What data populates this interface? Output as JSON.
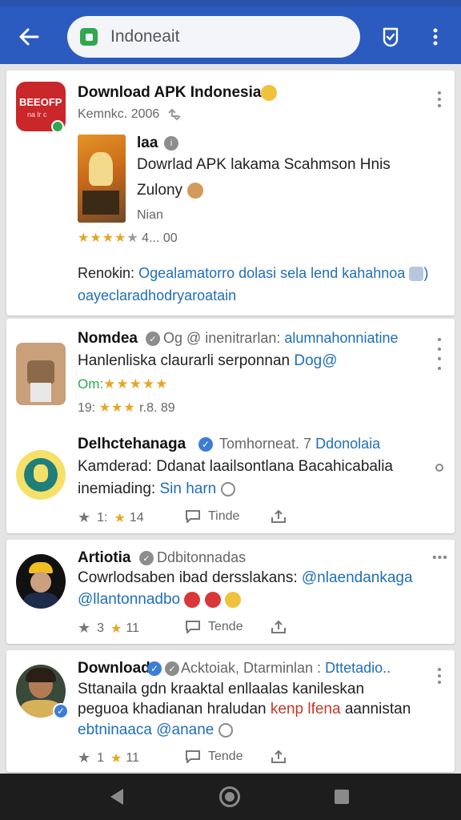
{
  "search": {
    "value": "Indoneait"
  },
  "posts": [
    {
      "title": "Download APK Indonesia",
      "meta": "Kemnkc. 2006",
      "avatar_text": "BEEOFP",
      "avatar_sub": "na lr c",
      "app": {
        "name": "laa",
        "desc_line1": "Dowrlad APK lakama Scahmson Hnis",
        "desc_line2": "Zulony",
        "sub": "Nian",
        "rating_text": "4... 00"
      },
      "footer_prefix": "Renokin:",
      "footer_link1": "Ogealamatorro dolasi sela lend kahahnoa",
      "footer_link2": "oayeclaradhodryaroatain"
    },
    {
      "title": "Nomdea",
      "meta_prefix": "Og @ inenitrarlan:",
      "meta_link": "alumnahonniatine",
      "body_text": "Hanlenliska claurarli serponnan",
      "body_link": "Dog@",
      "rating_prefix": "Om:",
      "rating_text": "19: ",
      "rating_suffix": "r.8. 89"
    },
    {
      "title": "Delhctehanaga",
      "meta_prefix": "Tomhorneat. 7",
      "meta_link": "Ddonolaia",
      "body_text": "Kamderad: Ddanat laailsontlana Bacahicabalia",
      "body2_text": "inemiading:",
      "body2_link": "Sin harn",
      "action_reposts": "1:",
      "action_likes": "14",
      "action_comments": "Tinde"
    },
    {
      "title": "Artiotia",
      "meta": "Ddbitonnadas",
      "body_text": "Cowrlodsaben ibad dersslakans:",
      "body_link": "@nlaendankaga",
      "body2_link": "@llantonnadbo",
      "action_reposts": "3",
      "action_likes": "11",
      "action_comments": "Tende"
    },
    {
      "title": "Download",
      "meta_prefix": "Acktoiak, Dtarminlan :",
      "meta_link": "Dttetadio..",
      "body_text": "Sttanaila gdn kraaktal enllaalas kanileskan",
      "body2_text": "peguoa khadianan hraludan",
      "body2_red": "kenp lfena",
      "body2_text_after": "aannistan",
      "body3_link": "ebtninaaca @anane",
      "action_reposts": "1",
      "action_likes": "11",
      "action_comments": "Tende"
    }
  ],
  "colors": {
    "topbar": "#2c5bbf",
    "link": "#1f6fb8",
    "star": "#e8a524",
    "navbar": "#1d1d1d"
  },
  "icons": [
    "back-arrow-icon",
    "app-icon",
    "shield-check-icon",
    "more-vert-icon",
    "retweet-icon",
    "star-icon",
    "comment-icon",
    "share-icon",
    "verified-icon",
    "nav-back-icon",
    "nav-home-icon",
    "nav-recent-icon"
  ]
}
